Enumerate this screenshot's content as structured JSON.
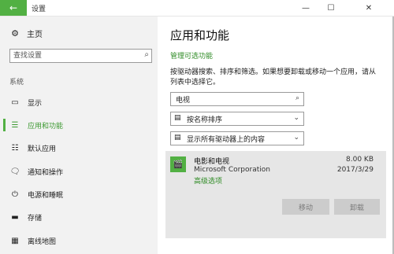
{
  "window": {
    "title": "设置",
    "controls": {
      "back": "←",
      "minimize": "—",
      "maximize": "☐",
      "close": "✕"
    }
  },
  "sidebar": {
    "home": {
      "icon": "gear-icon",
      "label": "主页"
    },
    "search": {
      "placeholder": "查找设置",
      "value": ""
    },
    "section_label": "系统",
    "items": [
      {
        "icon": "display-icon",
        "glyph": "▭",
        "label": "显示",
        "active": false
      },
      {
        "icon": "apps-list-icon",
        "glyph": "☰",
        "label": "应用和功能",
        "active": true
      },
      {
        "icon": "default-apps-icon",
        "glyph": "☷",
        "label": "默认应用",
        "active": false
      },
      {
        "icon": "notification-icon",
        "glyph": "🗨",
        "label": "通知和操作",
        "active": false
      },
      {
        "icon": "power-icon",
        "glyph": "⏻",
        "label": "电源和睡眠",
        "active": false
      },
      {
        "icon": "storage-icon",
        "glyph": "▬",
        "label": "存储",
        "active": false
      },
      {
        "icon": "offline-maps-icon",
        "glyph": "▦",
        "label": "离线地图",
        "active": false
      }
    ]
  },
  "main": {
    "title": "应用和功能",
    "optional_features_link": "管理可选功能",
    "description": "按驱动器搜索、排序和筛选。如果想要卸载或移动一个应用，请从列表中选择它。",
    "search_box": {
      "value": "电视"
    },
    "sort_dropdown": {
      "selected": "按名称排序"
    },
    "drive_dropdown": {
      "selected": "显示所有驱动器上的内容"
    },
    "app": {
      "icon": "movies-tv-icon",
      "name": "电影和电视",
      "publisher": "Microsoft Corporation",
      "advanced_link": "高级选项",
      "size": "8.00 KB",
      "date": "2017/3/29",
      "move_button": "移动",
      "uninstall_button": "卸载"
    }
  },
  "colors": {
    "accent": "#52b043",
    "link": "#2e8b24",
    "sidebar_bg": "#f2f2f2",
    "card_bg": "#e6e6e6"
  }
}
